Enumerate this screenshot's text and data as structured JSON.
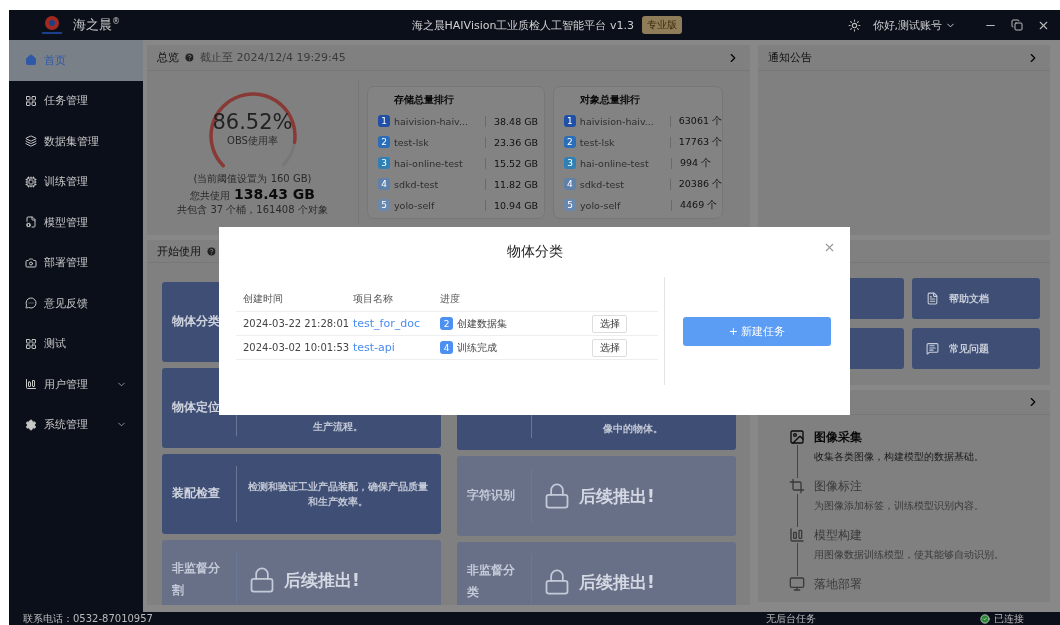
{
  "app": {
    "brand": "海之晨$^{®}$",
    "title": "海之晨HAIVision工业质检人工智能平台 v1.3",
    "edition": "专业版",
    "user": "你好,测试账号"
  },
  "sidebar": {
    "items": [
      {
        "label": "首页",
        "selected": true
      },
      {
        "label": "任务管理",
        "selected": false
      },
      {
        "label": "数据集管理",
        "selected": false
      },
      {
        "label": "训练管理",
        "selected": false
      },
      {
        "label": "模型管理",
        "selected": false
      },
      {
        "label": "部署管理",
        "selected": false
      },
      {
        "label": "意见反馈",
        "selected": false
      },
      {
        "label": "测试",
        "selected": false
      },
      {
        "label": "用户管理",
        "selected": false,
        "expanded": false
      },
      {
        "label": "系统管理",
        "selected": false,
        "expanded": false
      }
    ]
  },
  "overview": {
    "title": "总览",
    "as_of": "截止至 2024/12/4 19:29:45",
    "gauge": {
      "reading": "86.52%",
      "label": "OBS使用率"
    },
    "threshold": "(当前阈值设置为 160 GB)",
    "used_label": "您共使用",
    "used_value": "138.43 GB",
    "summary": "共包含 37 个桶，161408 个对象"
  },
  "storage_ranking": {
    "title": "存储总量排行",
    "rows": [
      {
        "rank": "1",
        "name": "haivision-haiv...",
        "value": "38.48 GB",
        "color": "#1f4fa6"
      },
      {
        "rank": "2",
        "name": "test-lsk",
        "value": "23.36 GB",
        "color": "#2a6db8"
      },
      {
        "rank": "3",
        "name": "hai-online-test",
        "value": "15.52 GB",
        "color": "#2f80b5"
      },
      {
        "rank": "4",
        "name": "sdkd-test",
        "value": "11.82 GB",
        "color": "#5f80a8"
      },
      {
        "rank": "5",
        "name": "yolo-self",
        "value": "10.94 GB",
        "color": "#6888ae"
      }
    ]
  },
  "object_ranking": {
    "title": "对象总量排行",
    "rows": [
      {
        "rank": "1",
        "name": "haivision-haiv...",
        "value": "63061 个",
        "color": "#1f4fa6"
      },
      {
        "rank": "2",
        "name": "test-lsk",
        "value": "17763 个",
        "color": "#2a6db8"
      },
      {
        "rank": "3",
        "name": "hai-online-test",
        "value": "994 个",
        "color": "#2f80b5"
      },
      {
        "rank": "4",
        "name": "sdkd-test",
        "value": "20386 个",
        "color": "#5f80a8"
      },
      {
        "rank": "5",
        "name": "yolo-self",
        "value": "4469 个",
        "color": "#6888ae"
      }
    ]
  },
  "notice": {
    "title": "通知公告"
  },
  "getting_started": {
    "title": "开始使用",
    "columns": [
      [
        {
          "title": "物体分类",
          "locked": false
        },
        {
          "title": "物体定位",
          "description": "生产流程。",
          "locked": false
        },
        {
          "title": "装配检查",
          "description": "检测和验证工业产品装配，确保产品质量和生产效率。",
          "locked": false
        },
        {
          "title": "非监督分割",
          "locked": true,
          "lock_text": "后续推出!"
        }
      ],
      [
        {
          "description": "像中的物体。",
          "locked": false
        },
        {
          "title": "字符识别",
          "locked": true,
          "lock_text": "后续推出!"
        },
        {
          "title": "非监督分类",
          "locked": true,
          "lock_text": "后续推出!"
        }
      ]
    ]
  },
  "quick_links": [
    {
      "kind": "covered"
    },
    {
      "kind": "link",
      "label": "帮助文档"
    },
    {
      "kind": "covered"
    },
    {
      "kind": "link",
      "label": "常见问题"
    }
  ],
  "process": {
    "steps": [
      {
        "title": "图像采集",
        "description": "收集各类图像，构建模型的数据基础。",
        "selected": true
      },
      {
        "title": "图像标注",
        "description": "为图像添加标签，训练模型识别内容。",
        "selected": false
      },
      {
        "title": "模型构建",
        "description": "用图像数据训练模型，使其能够自动识别。",
        "selected": false
      },
      {
        "title": "落地部署",
        "selected": false
      }
    ]
  },
  "status_bar": {
    "contact": "联系电话：0532-87010957",
    "tasks": "无后台任务",
    "connection": "已连接"
  },
  "modal": {
    "title": "物体分类",
    "columns": [
      "创建时间",
      "项目名称",
      "进度"
    ],
    "rows": [
      {
        "created": "2024-03-22 21:28:01",
        "project": "test_for_doc",
        "step": "2",
        "status": "创建数据集",
        "action": "选择"
      },
      {
        "created": "2024-03-02 10:01:53",
        "project": "test-api",
        "step": "4",
        "status": "训练完成",
        "action": "选择"
      }
    ],
    "new_button": "+ 新建任务"
  }
}
